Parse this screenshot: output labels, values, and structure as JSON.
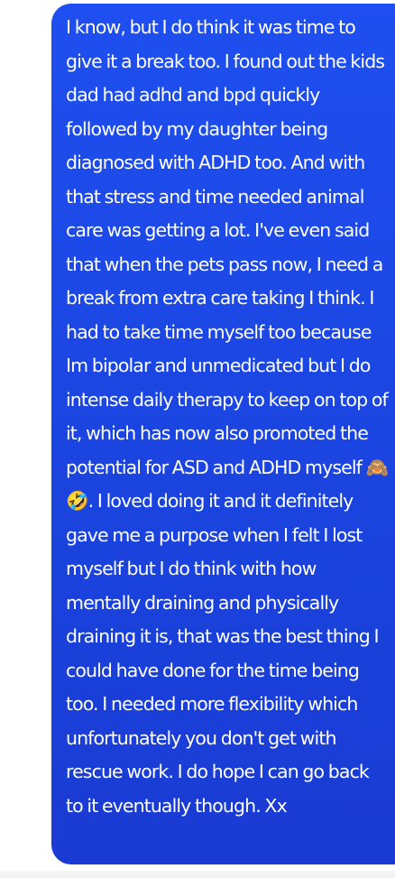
{
  "message": {
    "text": "I know, but I do think it was time to give it a break too. I found out the kids dad had adhd and bpd quickly followed by my daughter being diagnosed with ADHD too. And with that stress and time needed animal care was getting a lot. I've even said that when the pets pass now, I need a break from extra care taking I think. I had to take time myself too because Im bipolar and unmedicated but I do intense daily therapy to keep on top of it, which has now also promoted the potential for ASD and ADHD myself 🙈 🤣. I loved doing it and it definitely gave me a purpose when I felt I lost myself but I do think with how mentally draining and physically draining it is, that was the best thing I could have done for the time being too. I needed more flexibility which unfortunately you don't get with rescue work. I do hope I can go back to it eventually though. Xx",
    "bubble_color": "#1b46e2",
    "text_color": "#ffffff"
  }
}
